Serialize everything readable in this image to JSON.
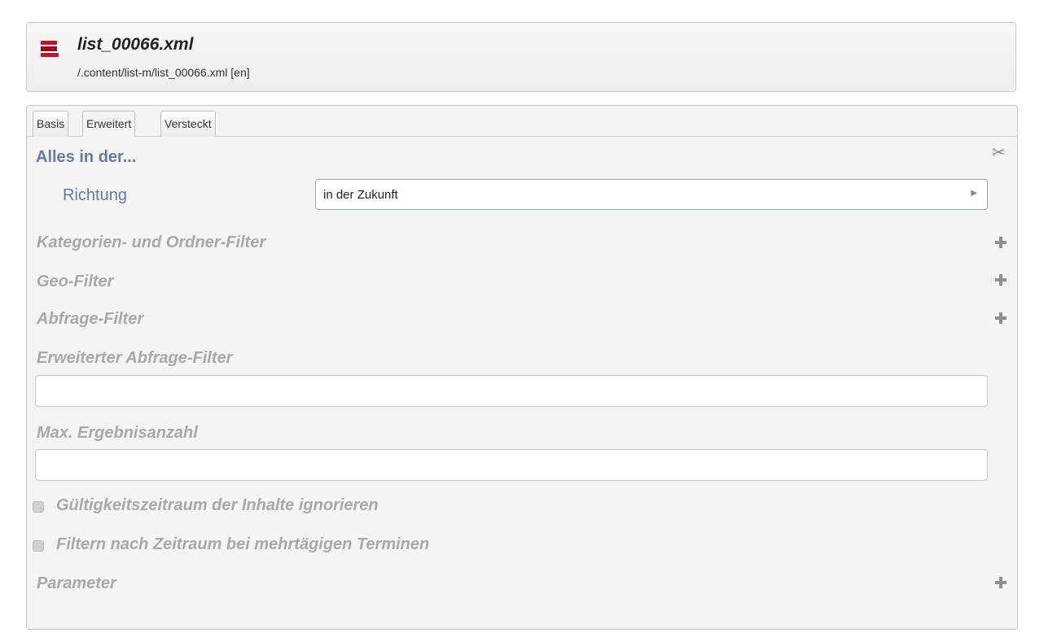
{
  "header": {
    "title": "list_00066.xml",
    "path": "/.content/list-m/list_00066.xml [en]",
    "icon": "list-file-icon"
  },
  "tabs": [
    {
      "label": "Basis"
    },
    {
      "label": "Erweitert",
      "active": true
    },
    {
      "label": "Versteckt"
    }
  ],
  "section": {
    "title": "Alles in der...",
    "richtung_label": "Richtung",
    "richtung_value": "in der Zukunft"
  },
  "groups": {
    "kategorien": "Kategorien- und Ordner-Filter",
    "geo": "Geo-Filter",
    "abfrage": "Abfrage-Filter",
    "erweiterter_abfrage": "Erweiterter Abfrage-Filter",
    "max_ergebnis": "Max. Ergebnisanzahl",
    "parameter": "Parameter"
  },
  "checkboxes": {
    "gueltigkeit": "Gültigkeitszeitraum der Inhalte ignorieren",
    "filtern": "Filtern nach Zeitraum bei mehrtägigen Terminen"
  },
  "inputs": {
    "erweiterter_abfrage_value": "",
    "max_ergebnis_value": ""
  },
  "colors": {
    "accent_label": "#6b7a99",
    "disabled_label": "#a8a8a8",
    "icon_red": "#c0142c"
  }
}
